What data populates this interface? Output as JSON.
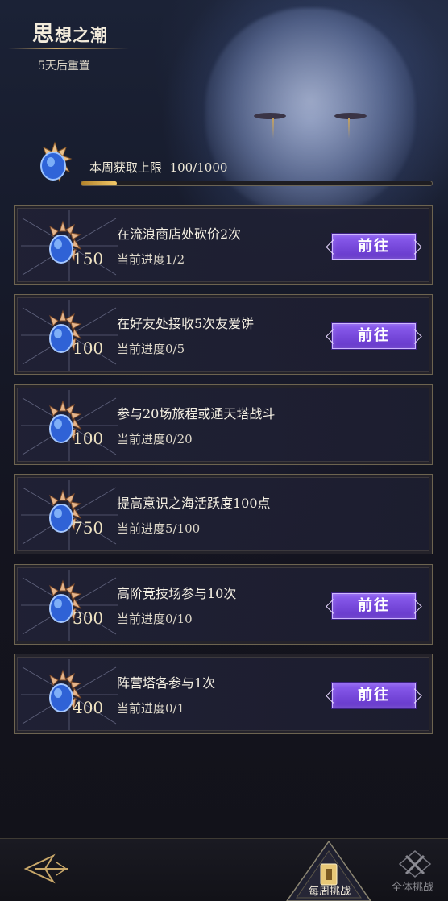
{
  "header": {
    "title_first": "思",
    "title_rest": "想之潮",
    "reset_text": "5天后重置"
  },
  "weekly_limit": {
    "label": "本周获取上限",
    "value_text": "100/1000",
    "progress_fraction": 0.1
  },
  "tasks": [
    {
      "reward": "150",
      "desc": "在流浪商店处砍价2次",
      "progress": "当前进度1/2",
      "button": "前往"
    },
    {
      "reward": "100",
      "desc": "在好友处接收5次友爱饼",
      "progress": "当前进度0/5",
      "button": "前往"
    },
    {
      "reward": "100",
      "desc": "参与20场旅程或通天塔战斗",
      "progress": "当前进度0/20",
      "button": ""
    },
    {
      "reward": "750",
      "desc": "提高意识之海活跃度100点",
      "progress": "当前进度5/100",
      "button": ""
    },
    {
      "reward": "300",
      "desc": "高阶竞技场参与10次",
      "progress": "当前进度0/10",
      "button": "前往"
    },
    {
      "reward": "400",
      "desc": "阵营塔各参与1次",
      "progress": "当前进度0/1",
      "button": "前往"
    }
  ],
  "bottom_nav": {
    "weekly_label": "每周挑战",
    "all_label": "全体挑战"
  },
  "icons": {
    "currency": "spiked-shell-blue-orb-icon",
    "back": "back-arrow-icon",
    "weekly": "shield-tab-icon",
    "all": "crossed-x-icon"
  },
  "colors": {
    "button_purple": "#7a4ae0",
    "accent_gold": "#c9a86a",
    "bar_fill": "#e0b04a"
  }
}
